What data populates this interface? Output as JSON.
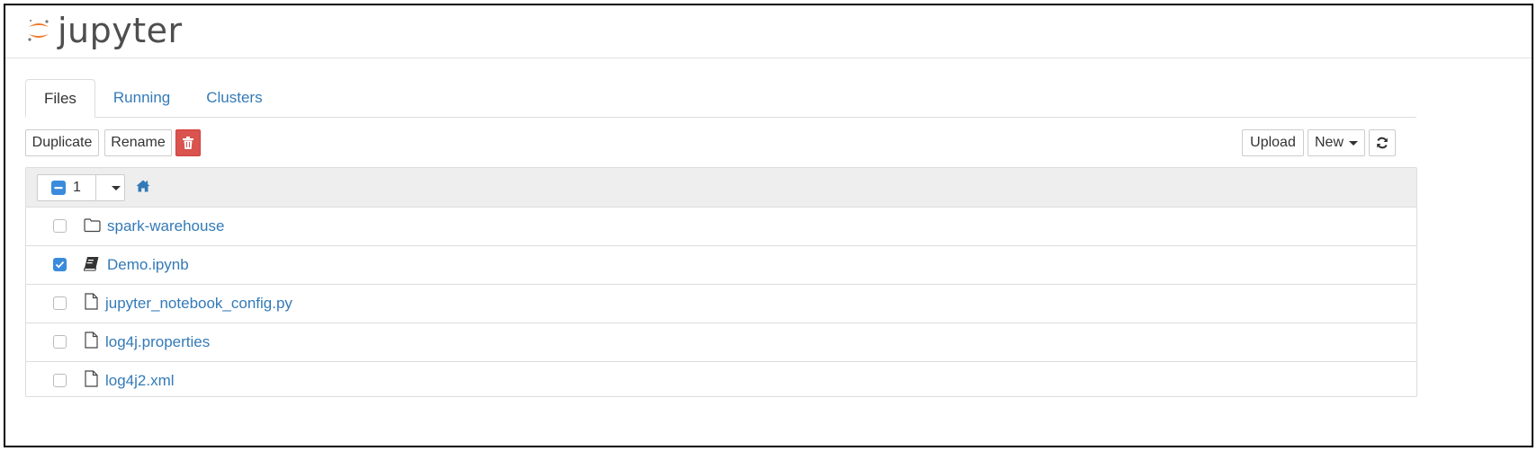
{
  "header": {
    "logo_text": "jupyter"
  },
  "tabs": [
    {
      "label": "Files",
      "active": true
    },
    {
      "label": "Running",
      "active": false
    },
    {
      "label": "Clusters",
      "active": false
    }
  ],
  "toolbar": {
    "duplicate_label": "Duplicate",
    "rename_label": "Rename",
    "delete_icon": "trash-icon",
    "upload_label": "Upload",
    "new_label": "New",
    "refresh_icon": "refresh-icon"
  },
  "list_header": {
    "selected_count": "1",
    "home_icon": "home-icon"
  },
  "files": [
    {
      "name": "spark-warehouse",
      "icon": "folder-icon",
      "checked": false
    },
    {
      "name": "Demo.ipynb",
      "icon": "notebook-icon",
      "checked": true
    },
    {
      "name": "jupyter_notebook_config.py",
      "icon": "file-icon",
      "checked": false
    },
    {
      "name": "log4j.properties",
      "icon": "file-icon",
      "checked": false
    },
    {
      "name": "log4j2.xml",
      "icon": "file-icon",
      "checked": false
    }
  ],
  "colors": {
    "link": "#337ab7",
    "danger": "#d9534f",
    "checkbox": "#3a8bdc",
    "logo_orange": "#f37726"
  }
}
